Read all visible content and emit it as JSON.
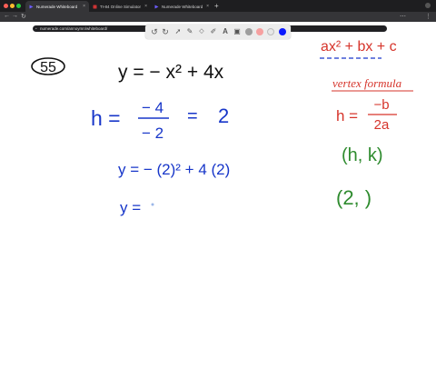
{
  "browser": {
    "tabs": [
      {
        "label": "Numerade Whiteboard",
        "active": true
      },
      {
        "label": "TI-84 Online Simulator",
        "active": false
      },
      {
        "label": "Numerade Whiteboard",
        "active": false
      }
    ],
    "new_tab_symbol": "+",
    "url": "numerade.com/annoymn/whiteboard/"
  },
  "toolbar": {
    "tools": [
      "undo-icon",
      "redo-icon",
      "select-icon",
      "pen-icon",
      "eraser-icon",
      "highlighter-icon",
      "text-icon",
      "image-icon"
    ],
    "colors": [
      "#9e9e9e",
      "#f6a0a0",
      "#e7e7e7",
      "#0d1aff"
    ]
  },
  "whiteboard": {
    "problem_number": "55",
    "equation": "y = − x² + 4x",
    "h_label": "h =",
    "h_numerator": "− 4",
    "h_denominator": "− 2",
    "h_equals": "=",
    "h_value": "2",
    "substitution": "y = − (2)² + 4 (2)",
    "y_result": "y =",
    "standard_form": "ax² + bx + c",
    "vertex_title": "vertex formula",
    "vertex_h": "h =",
    "vertex_numerator": "−b",
    "vertex_denominator": "2a",
    "vertex_pair": "(h, k)",
    "vertex_partial": "(2,  )",
    "colors": {
      "blue_ink": "#1736c9",
      "black_ink": "#111111",
      "red_ink": "#d6342b",
      "green_ink": "#2e8b2e"
    }
  }
}
